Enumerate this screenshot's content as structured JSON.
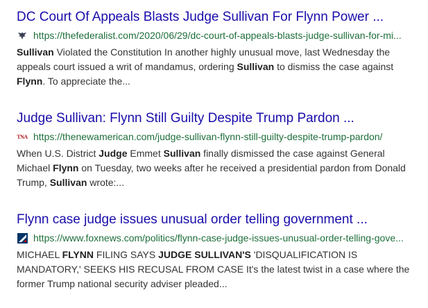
{
  "results": [
    {
      "title": "DC Court Of Appeals Blasts Judge Sullivan For Flynn Power ...",
      "url": "https://thefederalist.com/2020/06/29/dc-court-of-appeals-blasts-judge-sullivan-for-mi...",
      "favicon": "eagle-icon",
      "snippet": [
        {
          "text": "Sullivan",
          "bold": true
        },
        {
          "text": " Violated the Constitution In another highly unusual move, last Wednesday the appeals court issued a writ of mandamus, ordering ",
          "bold": false
        },
        {
          "text": "Sullivan",
          "bold": true
        },
        {
          "text": " to dismiss the case against ",
          "bold": false
        },
        {
          "text": "Flynn",
          "bold": true
        },
        {
          "text": ". To appreciate the...",
          "bold": false
        }
      ]
    },
    {
      "title": "Judge Sullivan: Flynn Still Guilty Despite Trump Pardon ...",
      "url": "https://thenewamerican.com/judge-sullivan-flynn-still-guilty-despite-trump-pardon/",
      "favicon": "tna-icon",
      "favicon_text": "TNA",
      "snippet": [
        {
          "text": "When U.S. District ",
          "bold": false
        },
        {
          "text": "Judge",
          "bold": true
        },
        {
          "text": " Emmet ",
          "bold": false
        },
        {
          "text": "Sullivan",
          "bold": true
        },
        {
          "text": " finally dismissed the case against General Michael ",
          "bold": false
        },
        {
          "text": "Flynn",
          "bold": true
        },
        {
          "text": " on Tuesday, two weeks after he received a presidential pardon from Donald Trump, ",
          "bold": false
        },
        {
          "text": "Sullivan",
          "bold": true
        },
        {
          "text": " wrote:...",
          "bold": false
        }
      ]
    },
    {
      "title": "Flynn case judge issues unusual order telling government ...",
      "url": "https://www.foxnews.com/politics/flynn-case-judge-issues-unusual-order-telling-gove...",
      "favicon": "foxnews-icon",
      "snippet": [
        {
          "text": "MICHAEL ",
          "bold": false
        },
        {
          "text": "FLYNN",
          "bold": true
        },
        {
          "text": " FILING SAYS ",
          "bold": false
        },
        {
          "text": "JUDGE SULLIVAN'S",
          "bold": true
        },
        {
          "text": " 'DISQUALIFICATION IS MANDATORY,' SEEKS HIS RECUSAL FROM CASE It's the latest twist in a case where the former Trump national security adviser pleaded...",
          "bold": false
        }
      ]
    }
  ],
  "colors": {
    "title": "#1a0dab",
    "url": "#1e6e3a",
    "snippet": "#333333"
  }
}
